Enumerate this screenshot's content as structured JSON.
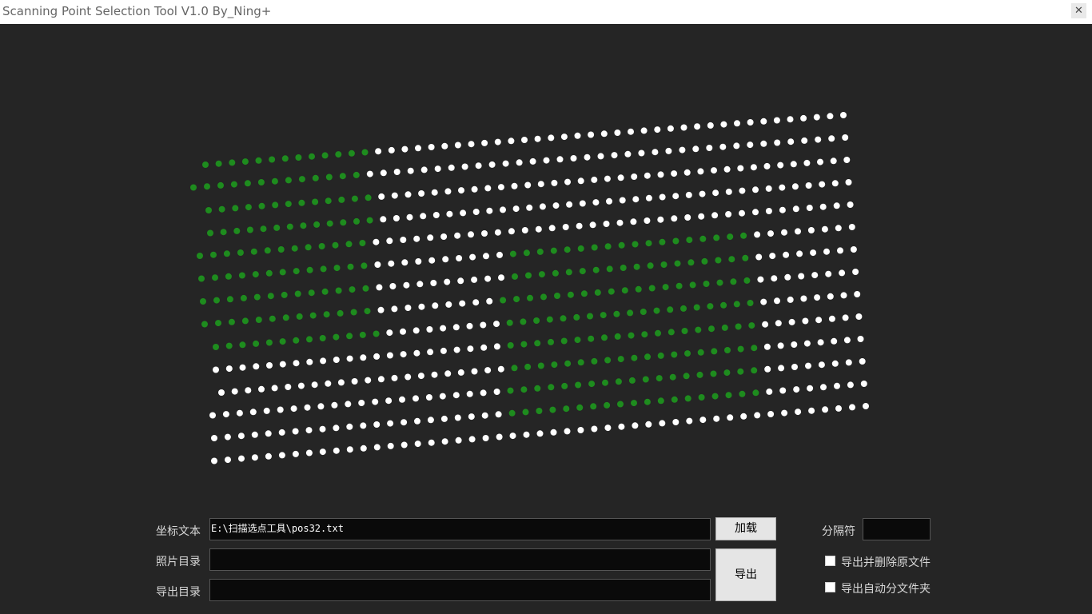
{
  "window": {
    "title": "Scanning Point Selection Tool V1.0 By_Ning+",
    "close_icon": "close-icon"
  },
  "form": {
    "coord_label": "坐标文本",
    "coord_value": "E:\\扫描选点工具\\pos32.txt",
    "photo_label": "照片目录",
    "photo_value": "",
    "export_label": "导出目录",
    "export_value": "",
    "load_button": "加载",
    "export_button": "导出",
    "separator_label": "分隔符",
    "separator_value": "",
    "option_delete_label": "导出并删除原文件",
    "option_delete_checked": false,
    "option_subfolder_label": "导出自动分文件夹",
    "option_subfolder_checked": false
  },
  "scan_grid": {
    "rows": 14,
    "points_per_row": 49,
    "selected_color": "#1e8c1e",
    "unselected_color": "#ffffff",
    "selected_ranges": [
      [
        [
          0,
          12
        ]
      ],
      [
        [
          0,
          12
        ]
      ],
      [
        [
          0,
          12
        ]
      ],
      [
        [
          0,
          12
        ]
      ],
      [
        [
          0,
          12
        ]
      ],
      [
        [
          0,
          12
        ],
        [
          23,
          40
        ]
      ],
      [
        [
          0,
          12
        ],
        [
          23,
          40
        ]
      ],
      [
        [
          0,
          12
        ],
        [
          22,
          40
        ]
      ],
      [
        [
          0,
          12
        ],
        [
          22,
          40
        ]
      ],
      [
        [
          22,
          40
        ]
      ],
      [
        [
          22,
          40
        ]
      ],
      [
        [
          22,
          40
        ]
      ],
      [
        [
          22,
          40
        ]
      ],
      []
    ]
  }
}
